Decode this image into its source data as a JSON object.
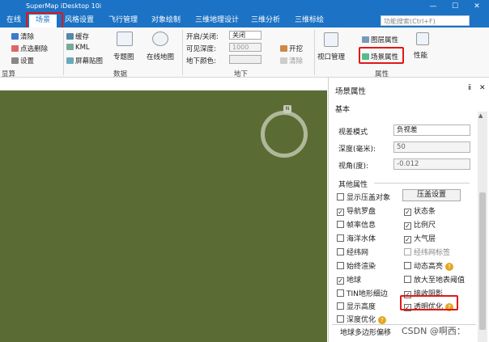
{
  "window": {
    "title": "SuperMap iDesktop 10i",
    "min": "—",
    "max": "☐",
    "close": "✕"
  },
  "tabs": [
    {
      "label": "在线"
    },
    {
      "label": "场景"
    },
    {
      "label": "风格设置"
    },
    {
      "label": "飞行管理"
    },
    {
      "label": "对象绘制"
    },
    {
      "label": "三维地理设计"
    },
    {
      "label": "三维分析"
    },
    {
      "label": "三维标绘"
    }
  ],
  "search_placeholder": "功能搜索(Ctrl+F)",
  "ribbon": {
    "group_basic": {
      "label": "显算",
      "clear": "清除",
      "point_remove": "点选删除",
      "settings": "设置"
    },
    "group_data": {
      "label": "数据",
      "cache": "缓存",
      "kml": "KML",
      "screenshot": "屏幕贴图",
      "theme_map": "专题图",
      "online_map": "在线地图"
    },
    "group_underground": {
      "label": "地下",
      "toggle_label": "开启/关闭:",
      "toggle_value": "关闭",
      "visible_depth_label": "可见深度:",
      "visible_depth_value": "1000",
      "ground_color_label": "地下颜色:",
      "open": "开挖",
      "clear": "清除"
    },
    "group_attr": {
      "label": "属性",
      "viewport_mgmt": "视口管理",
      "layer_props": "图层属性",
      "scene_props": "场景属性",
      "performance": "性能"
    }
  },
  "panel": {
    "title": "场景属性",
    "pin": "ⅱ",
    "close": "✕",
    "tab": "基本",
    "view_mode_label": "视差模式",
    "view_mode_value": "负视差",
    "depth_label": "深度(毫米):",
    "depth_value": "50",
    "angle_label": "视角(度):",
    "angle_value": "-0.012",
    "other_section": "其他属性",
    "press_button": "压盖设置",
    "checks": [
      {
        "label": "显示压盖对象",
        "checked": false
      },
      {
        "label": "导航罗盘",
        "checked": true
      },
      {
        "label": "状态条",
        "checked": true
      },
      {
        "label": "帧率信息",
        "checked": false
      },
      {
        "label": "比例尺",
        "checked": true
      },
      {
        "label": "海洋水体",
        "checked": false
      },
      {
        "label": "大气层",
        "checked": true
      },
      {
        "label": "经纬网",
        "checked": false
      },
      {
        "label": "经纬网标签",
        "checked": false
      },
      {
        "label": "始终渲染",
        "checked": false
      },
      {
        "label": "动态高亮",
        "checked": false
      },
      {
        "label": "地球",
        "checked": true
      },
      {
        "label": "放大至地表阈值",
        "checked": false
      },
      {
        "label": "TIN地形细边",
        "checked": false
      },
      {
        "label": "接收阴影",
        "checked": true
      },
      {
        "label": "显示高度",
        "checked": false
      },
      {
        "label": "透明优化",
        "checked": true
      },
      {
        "label": "深度优化",
        "checked": false
      }
    ],
    "footer_group": "地球多边形偏移"
  },
  "viewport": {
    "compass_n": "N"
  },
  "watermark": "CSDN @啊西：",
  "colors": {
    "title_bar": "#1c72c4",
    "ground": "#5a6c33",
    "highlight": "#e01818",
    "help": "#e5a520"
  }
}
